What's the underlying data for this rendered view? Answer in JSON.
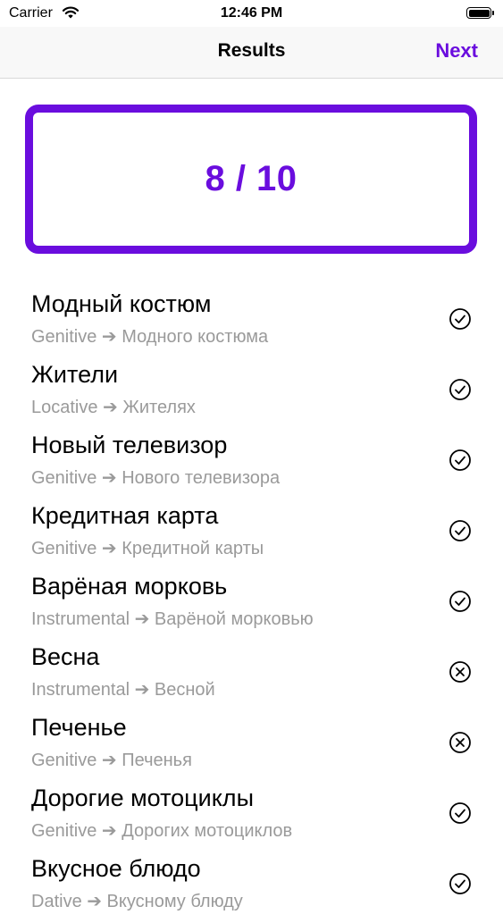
{
  "status_bar": {
    "carrier": "Carrier",
    "time": "12:46 PM"
  },
  "nav": {
    "title": "Results",
    "next_label": "Next"
  },
  "score": "8 / 10",
  "accent_color": "#6a0dde",
  "results": [
    {
      "phrase": "Модный костюм",
      "answer": "Genitive ➔ Модного костюма",
      "status": "check-circle-icon"
    },
    {
      "phrase": "Жители",
      "answer": "Locative ➔ Жителях",
      "status": "check-circle-icon"
    },
    {
      "phrase": "Новый телевизор",
      "answer": "Genitive ➔ Нового телевизора",
      "status": "check-circle-icon"
    },
    {
      "phrase": "Кредитная карта",
      "answer": "Genitive ➔ Кредитной карты",
      "status": "check-circle-icon"
    },
    {
      "phrase": "Варёная морковь",
      "answer": "Instrumental ➔ Варёной морковью",
      "status": "check-circle-icon"
    },
    {
      "phrase": "Весна",
      "answer": "Instrumental ➔ Весной",
      "status": "x-circle-icon"
    },
    {
      "phrase": "Печенье",
      "answer": "Genitive ➔ Печенья",
      "status": "x-circle-icon"
    },
    {
      "phrase": "Дорогие мотоциклы",
      "answer": "Genitive ➔ Дорогих мотоциклов",
      "status": "check-circle-icon"
    },
    {
      "phrase": "Вкусное блюдо",
      "answer": "Dative ➔ Вкусному блюду",
      "status": "check-circle-icon"
    }
  ]
}
